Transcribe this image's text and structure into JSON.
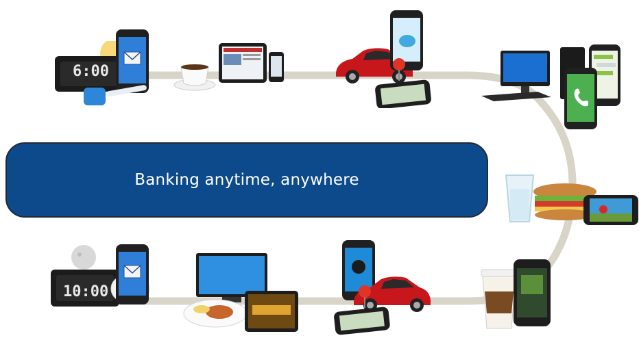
{
  "banner": {
    "text": "Banking anytime, anywhere"
  },
  "clocks": {
    "morning": "6:00",
    "night": "10:00"
  },
  "colors": {
    "banner_bg": "#0d4a8c",
    "path": "#d9d4c8",
    "car": "#c8161d",
    "screen": "#1a6fd0"
  },
  "icons": [
    "alarm-clock-icon",
    "smartphone-icon",
    "toothbrush-icon",
    "coffee-cup-icon",
    "tablet-icon",
    "car-icon",
    "map-pin-icon",
    "twitter-bird-icon",
    "desktop-computer-icon",
    "phone-call-icon",
    "water-glass-icon",
    "sandwich-icon",
    "game-phone-icon",
    "moon-icon",
    "laptop-tv-icon",
    "dinner-plate-icon",
    "music-phone-icon",
    "takeaway-coffee-icon"
  ]
}
